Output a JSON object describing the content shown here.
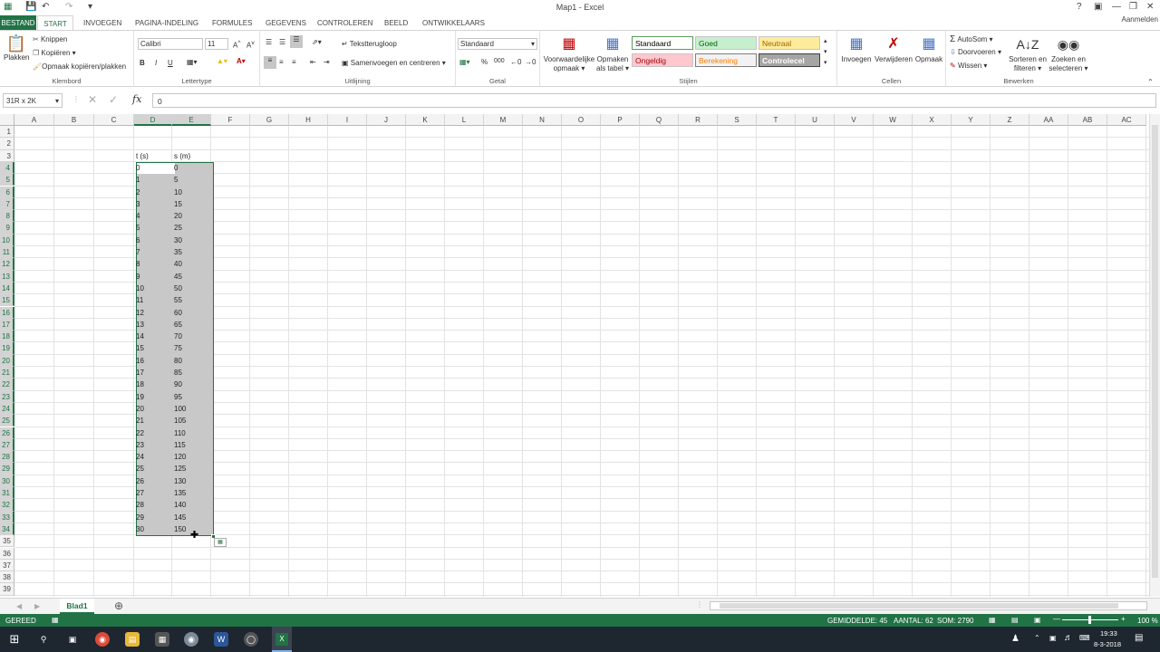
{
  "window": {
    "title": "Map1 - Excel",
    "signin": "Aanmelden"
  },
  "tabs": {
    "file": "BESTAND",
    "items": [
      "START",
      "INVOEGEN",
      "PAGINA-INDELING",
      "FORMULES",
      "GEGEVENS",
      "CONTROLEREN",
      "BEELD",
      "ONTWIKKELAARS"
    ]
  },
  "ribbon": {
    "clipboard": {
      "label": "Klembord",
      "paste": "Plakken",
      "cut": "Knippen",
      "copy": "Kopiëren",
      "format_painter": "Opmaak kopiëren/plakken"
    },
    "font": {
      "label": "Lettertype",
      "name": "Calibri",
      "size": "11",
      "bold": "B",
      "italic": "I",
      "underline": "U"
    },
    "alignment": {
      "label": "Uitlijning",
      "wrap": "Tekstterugloop",
      "merge": "Samenvoegen en centreren"
    },
    "number": {
      "label": "Getal",
      "format": "Standaard",
      "percent": "%",
      "thousands": "000"
    },
    "styles": {
      "label": "Stijlen",
      "conditional": "Voorwaardelijke opmaak",
      "as_table": "Opmaken als tabel",
      "cells": [
        {
          "name": "Standaard",
          "bg": "#ffffff",
          "fg": "#000000",
          "border": "#5b9b5b"
        },
        {
          "name": "Goed",
          "bg": "#c6efce",
          "fg": "#006100",
          "border": "#c6c6c6"
        },
        {
          "name": "Neutraal",
          "bg": "#ffeb9c",
          "fg": "#9c6500",
          "border": "#c6c6c6"
        },
        {
          "name": "Ongeldig",
          "bg": "#ffc7ce",
          "fg": "#9c0006",
          "border": "#c6c6c6"
        },
        {
          "name": "Berekening",
          "bg": "#f2f2f2",
          "fg": "#fa7d00",
          "border": "#7f7f7f"
        },
        {
          "name": "Controlecel",
          "bg": "#a5a5a5",
          "fg": "#ffffff",
          "border": "#3f3f3f"
        }
      ]
    },
    "cells": {
      "label": "Cellen",
      "insert": "Invoegen",
      "delete": "Verwijderen",
      "format": "Opmaak"
    },
    "editing": {
      "label": "Bewerken",
      "autosum": "AutoSom",
      "fill": "Doorvoeren",
      "clear": "Wissen",
      "sort": "Sorteren en filteren",
      "find": "Zoeken en selecteren"
    }
  },
  "formula_bar": {
    "name_box": "31R x 2K",
    "fx": "fx",
    "value": "0"
  },
  "grid": {
    "columns": [
      "A",
      "B",
      "C",
      "D",
      "E",
      "F",
      "G",
      "H",
      "I",
      "J",
      "K",
      "L",
      "M",
      "N",
      "O",
      "P",
      "Q",
      "R",
      "S",
      "T",
      "U",
      "V",
      "W",
      "X",
      "Y",
      "Z",
      "AA",
      "AB",
      "AC"
    ],
    "rows": [
      "1",
      "2",
      "3",
      "4",
      "5",
      "6",
      "7",
      "8",
      "9",
      "10",
      "11",
      "12",
      "13",
      "14",
      "15",
      "16",
      "17",
      "18",
      "19",
      "20",
      "21",
      "22",
      "23",
      "24",
      "25",
      "26",
      "27",
      "28",
      "29",
      "30",
      "31",
      "32",
      "33",
      "34",
      "35",
      "36",
      "37",
      "38",
      "39"
    ],
    "header_t": "t (s)",
    "header_s": "s (m)",
    "t_values": [
      "0",
      "1",
      "2",
      "3",
      "4",
      "5",
      "6",
      "7",
      "8",
      "9",
      "10",
      "11",
      "12",
      "13",
      "14",
      "15",
      "16",
      "17",
      "18",
      "19",
      "20",
      "21",
      "22",
      "23",
      "24",
      "25",
      "26",
      "27",
      "28",
      "29",
      "30"
    ],
    "s_values": [
      "0",
      "5",
      "10",
      "15",
      "20",
      "25",
      "30",
      "35",
      "40",
      "45",
      "50",
      "55",
      "60",
      "65",
      "70",
      "75",
      "80",
      "85",
      "90",
      "95",
      "100",
      "105",
      "110",
      "115",
      "120",
      "125",
      "130",
      "135",
      "140",
      "145",
      "150"
    ]
  },
  "sheets": {
    "active": "Blad1"
  },
  "status": {
    "mode": "GEREED",
    "average": "GEMIDDELDE: 45",
    "count": "AANTAL: 62",
    "sum": "SOM: 2790",
    "zoom": "100 %"
  },
  "taskbar": {
    "time": "19:33",
    "date": "8-3-2018"
  },
  "colors": {
    "accent": "#217346",
    "selection": "#c8c8c8"
  }
}
